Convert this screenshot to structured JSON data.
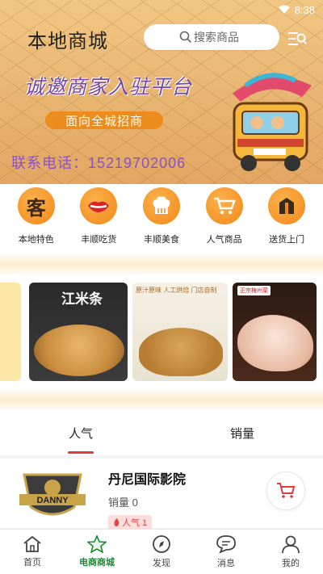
{
  "status_bar": {
    "time": "8:38"
  },
  "header": {
    "title": "本地商城",
    "search_placeholder": "搜索商品"
  },
  "banner": {
    "headline": "诚邀商家入驻平台",
    "button": "面向全城招商",
    "contact": "联系电话：15219702006"
  },
  "categories": [
    {
      "label": "本地特色",
      "icon": "ke-char-icon",
      "glyph": "客"
    },
    {
      "label": "丰顺吃货",
      "icon": "lips-icon",
      "glyph": ""
    },
    {
      "label": "丰顺美食",
      "icon": "chef-hat-icon",
      "glyph": ""
    },
    {
      "label": "人气商品",
      "icon": "cart-icon",
      "glyph": ""
    },
    {
      "label": "送货上门",
      "icon": "delivery-box-icon",
      "glyph": ""
    }
  ],
  "products": [
    {
      "title": "江米条"
    },
    {
      "tag": "原汁原味 人工烘焙 门店自制"
    },
    {
      "badge": "正宗梅州菜"
    }
  ],
  "tabs": [
    {
      "label": "人气",
      "active": true
    },
    {
      "label": "销量",
      "active": false
    }
  ],
  "shop": {
    "name": "丹尼国际影院",
    "sales": "销量 0",
    "popularity_badge": "人气 1",
    "logo_text": "DANNY"
  },
  "bottom_nav": [
    {
      "label": "首页",
      "icon": "home-icon",
      "active": false
    },
    {
      "label": "电商商城",
      "icon": "star-icon",
      "active": true
    },
    {
      "label": "发现",
      "icon": "compass-icon",
      "active": false
    },
    {
      "label": "消息",
      "icon": "message-icon",
      "active": false
    },
    {
      "label": "我的",
      "icon": "user-icon",
      "active": false
    }
  ],
  "colors": {
    "accent_red": "#e03a3a",
    "nav_active": "#1d8a33",
    "category_orange": "#f2871a",
    "banner_purple": "#8a52c4"
  }
}
